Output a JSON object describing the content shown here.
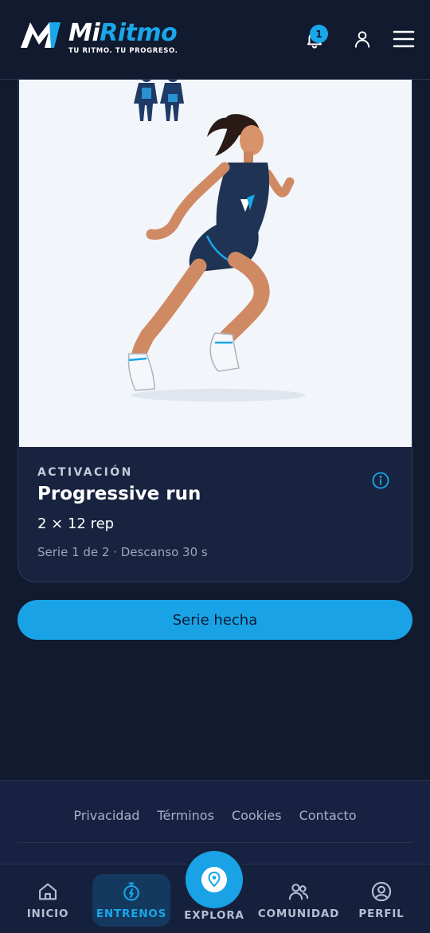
{
  "header": {
    "brand_mi": "Mi",
    "brand_ritmo": "Ritmo",
    "tagline": "TU RITMO. TU PROGRESO.",
    "notification_count": "1",
    "icons": [
      "bell-icon",
      "user-icon",
      "menu-icon"
    ]
  },
  "exercise": {
    "section": "ACTIVACIÓN",
    "name": "Progressive run",
    "sets_reps": "2 × 12 rep",
    "serie_info": "Serie 1 de 2 · Descanso 30 s"
  },
  "actions": {
    "primary_label": "Serie hecha"
  },
  "footer": {
    "links": [
      "Privacidad",
      "Términos",
      "Cookies",
      "Contacto"
    ]
  },
  "nav": {
    "items": [
      {
        "label": "INICIO",
        "icon": "home-icon"
      },
      {
        "label": "ENTRENOS",
        "icon": "stopwatch-icon",
        "active": true
      },
      {
        "label": "EXPLORA",
        "icon": "location-pin-icon"
      },
      {
        "label": "COMUNIDAD",
        "icon": "users-icon"
      },
      {
        "label": "PERFIL",
        "icon": "profile-icon"
      }
    ]
  },
  "colors": {
    "background": "#111a2e",
    "accent": "#19a7ea",
    "card": "#17233f"
  }
}
